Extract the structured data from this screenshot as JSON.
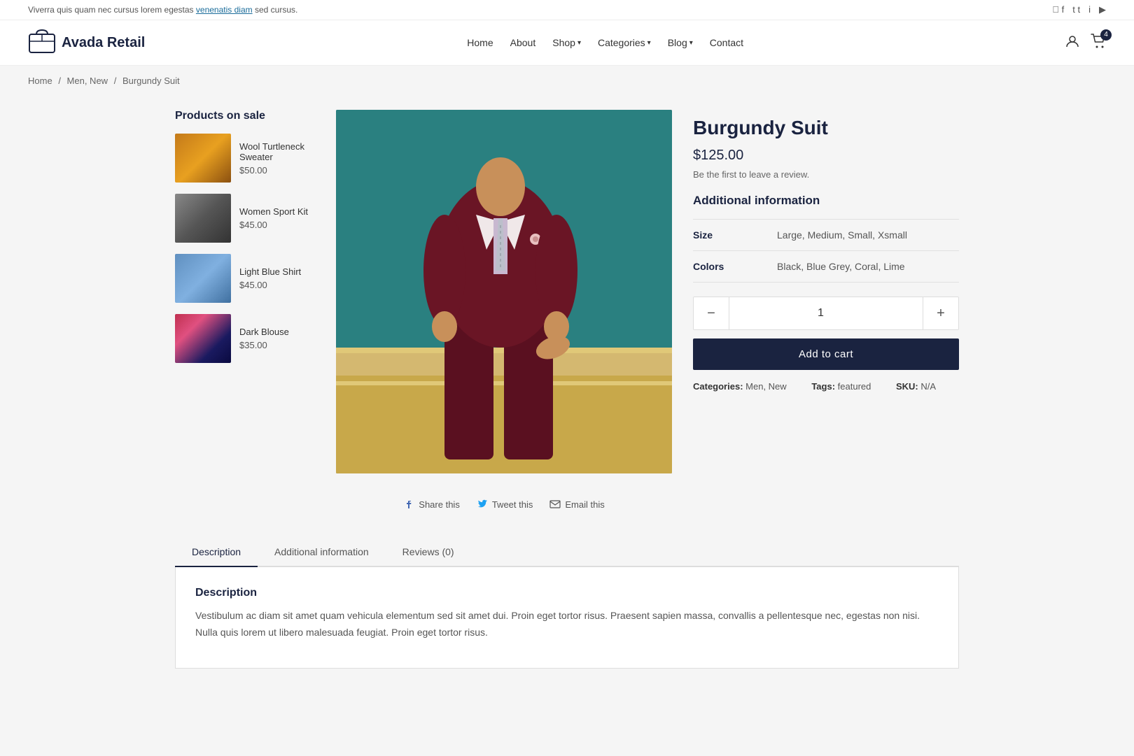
{
  "top_bar": {
    "announcement": "Viverra quis quam nec cursus lorem egestas",
    "announcement_link": "venenatis diam",
    "announcement_suffix": " sed cursus.",
    "social": [
      "facebook",
      "twitter",
      "instagram",
      "youtube"
    ]
  },
  "header": {
    "logo_text": "Avada Retail",
    "nav": [
      {
        "label": "Home",
        "has_dropdown": false
      },
      {
        "label": "About",
        "has_dropdown": false
      },
      {
        "label": "Shop",
        "has_dropdown": true
      },
      {
        "label": "Categories",
        "has_dropdown": true
      },
      {
        "label": "Blog",
        "has_dropdown": true
      },
      {
        "label": "Contact",
        "has_dropdown": false
      }
    ],
    "cart_count": "4"
  },
  "breadcrumb": {
    "items": [
      "Home",
      "Men, New",
      "Burgundy Suit"
    ]
  },
  "sidebar": {
    "title": "Products on sale",
    "items": [
      {
        "name": "Wool Turtleneck Sweater",
        "price": "$50.00",
        "img_class": "img-wool"
      },
      {
        "name": "Women Sport Kit",
        "price": "$45.00",
        "img_class": "img-sport"
      },
      {
        "name": "Light Blue Shirt",
        "price": "$45.00",
        "img_class": "img-shirt"
      },
      {
        "name": "Dark Blouse",
        "price": "$35.00",
        "img_class": "img-blouse"
      }
    ]
  },
  "product": {
    "title": "Burgundy Suit",
    "price": "$125.00",
    "review_text": "Be the first to leave a review.",
    "additional_info_title": "Additional information",
    "size_label": "Size",
    "size_value": "Large, Medium, Small, Xsmall",
    "colors_label": "Colors",
    "colors_value": "Black, Blue Grey, Coral, Lime",
    "quantity": "1",
    "add_to_cart_label": "Add to cart",
    "categories_label": "Categories:",
    "categories_value": "Men, New",
    "tags_label": "Tags:",
    "tags_value": "featured",
    "sku_label": "SKU:",
    "sku_value": "N/A"
  },
  "share": {
    "facebook_label": "Share this",
    "twitter_label": "Tweet this",
    "email_label": "Email this"
  },
  "tabs": {
    "items": [
      {
        "label": "Description",
        "active": true
      },
      {
        "label": "Additional information",
        "active": false
      },
      {
        "label": "Reviews (0)",
        "active": false
      }
    ],
    "description_title": "Description",
    "description_text_1": "Vestibulum ac diam sit amet quam vehicula elementum sed sit amet dui. Proin eget tortor risus. Praesent sapien massa, convallis a pellentesque nec, egestas non nisi. Nulla quis lorem ut libero malesuada feugiat. Proin eget tortor risus.",
    "description_text_2": ""
  }
}
